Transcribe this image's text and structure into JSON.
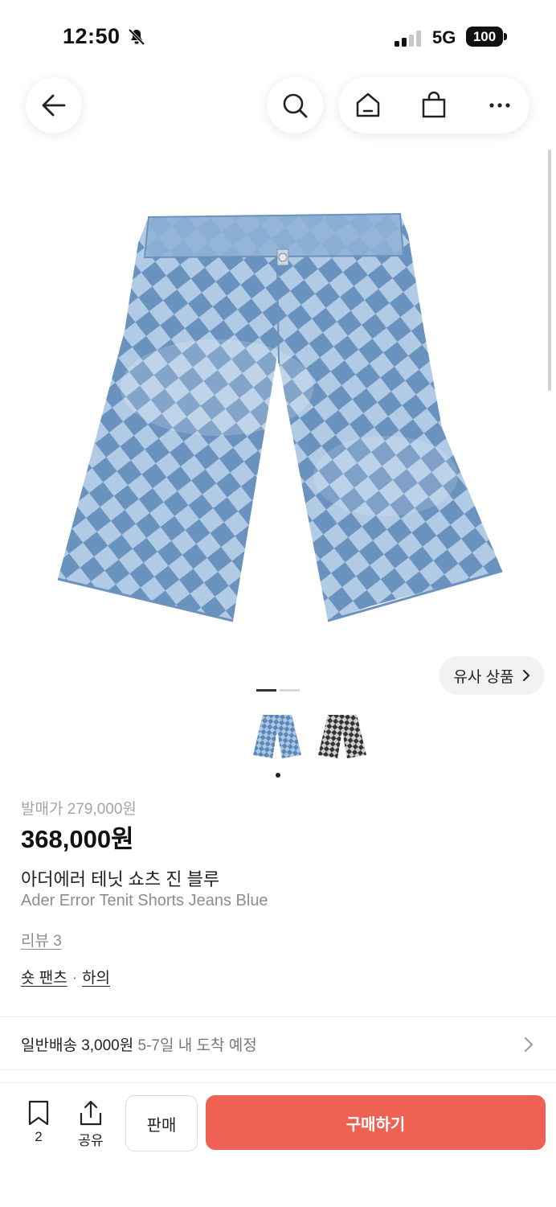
{
  "status_bar": {
    "time": "12:50",
    "network": "5G",
    "battery": "100"
  },
  "nav": {
    "back_icon": "arrow-left-icon",
    "search_icon": "search-icon",
    "home_icon": "home-icon",
    "bag_icon": "shopping-bag-icon",
    "more_icon": "more-icon"
  },
  "gallery": {
    "similar_label": "유사 상품",
    "thumb_count": 2,
    "active_index": 0
  },
  "product": {
    "release_price": "발매가 279,000원",
    "price": "368,000원",
    "name_ko": "아더에러 테닛 쇼츠 진 블루",
    "name_en": "Ader Error Tenit Shorts Jeans Blue",
    "review": "리뷰 3",
    "category_1": "숏 팬츠",
    "category_sep": "·",
    "category_2": "하의"
  },
  "shipping": {
    "label": "일반배송 3,000원",
    "eta": "5-7일 내 도착 예정"
  },
  "bottom_bar": {
    "bookmark_count": "2",
    "share_label": "공유",
    "sell_label": "판매",
    "buy_label": "구매하기"
  },
  "colors": {
    "buy": "#ef6253",
    "denim_light": "#a9c6e3",
    "denim_dark": "#5a86b8"
  }
}
